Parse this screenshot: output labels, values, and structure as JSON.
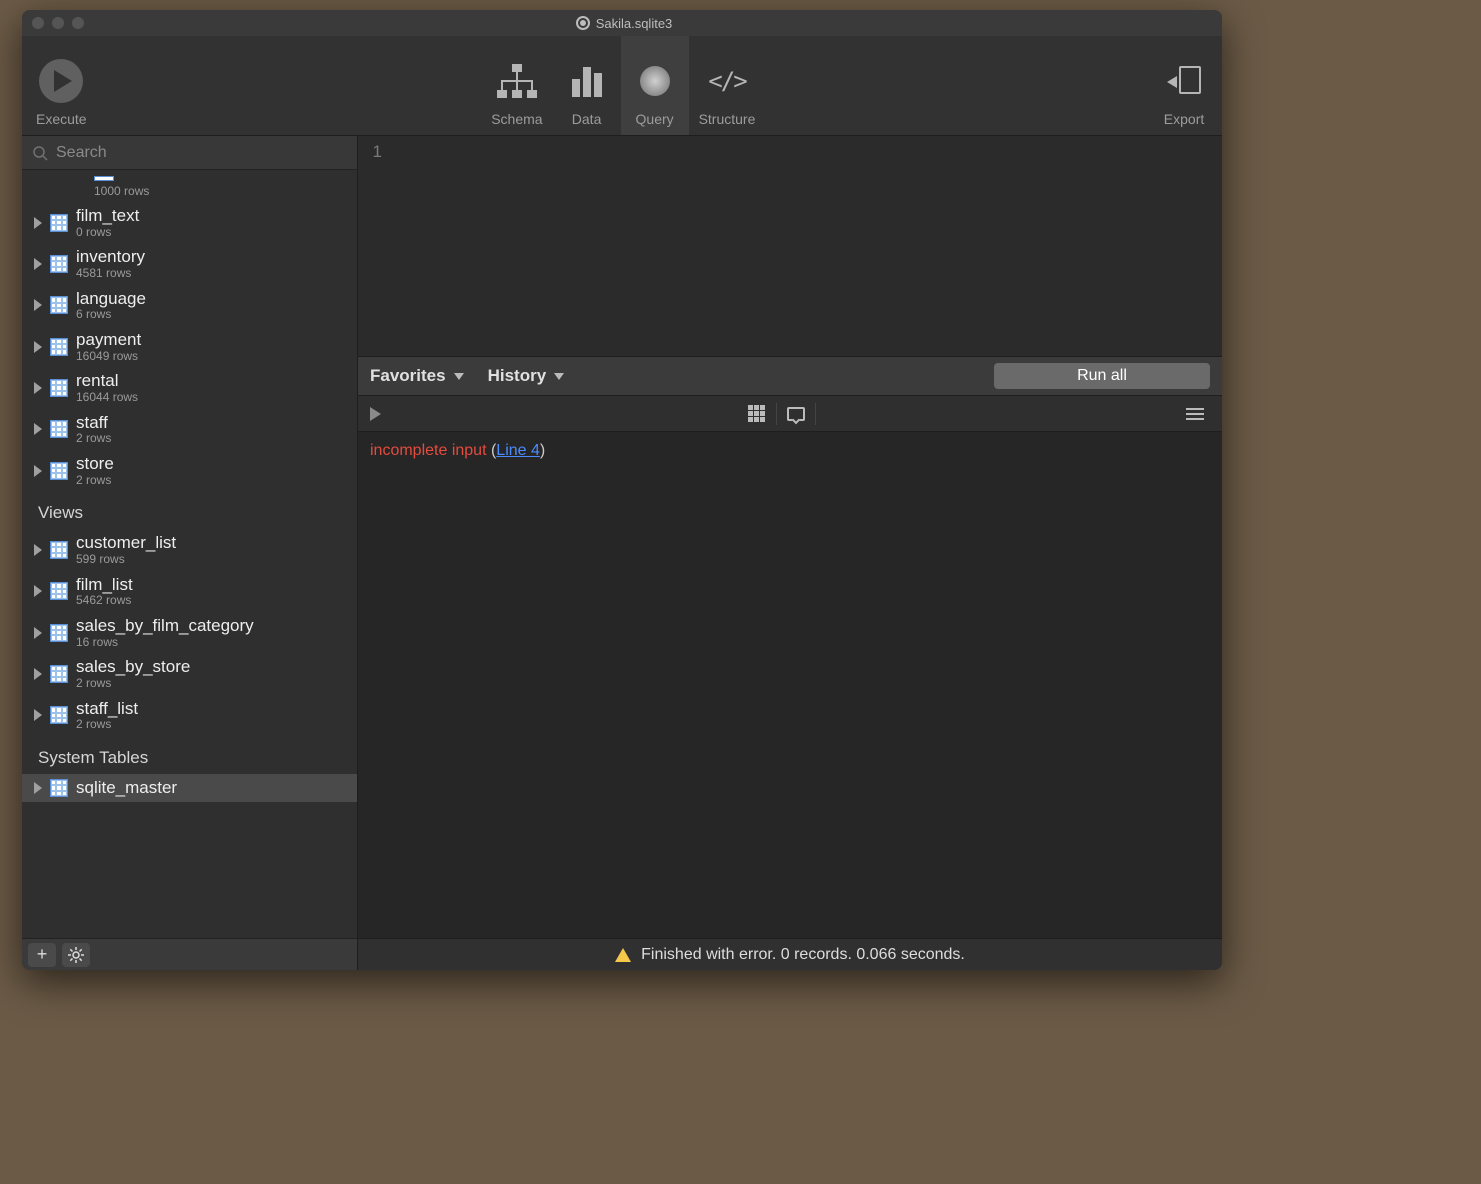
{
  "window_title": "Sakila.sqlite3",
  "toolbar": {
    "execute": "Execute",
    "schema": "Schema",
    "data": "Data",
    "query": "Query",
    "structure": "Structure",
    "export": "Export"
  },
  "search_placeholder": "Search",
  "sidebar": {
    "top_fragment_rows": "1000 rows",
    "tables": [
      {
        "name": "film_text",
        "rows": "0 rows"
      },
      {
        "name": "inventory",
        "rows": "4581 rows"
      },
      {
        "name": "language",
        "rows": "6 rows"
      },
      {
        "name": "payment",
        "rows": "16049 rows"
      },
      {
        "name": "rental",
        "rows": "16044 rows"
      },
      {
        "name": "staff",
        "rows": "2 rows"
      },
      {
        "name": "store",
        "rows": "2 rows"
      }
    ],
    "views_header": "Views",
    "views": [
      {
        "name": "customer_list",
        "rows": "599 rows"
      },
      {
        "name": "film_list",
        "rows": "5462 rows"
      },
      {
        "name": "sales_by_film_category",
        "rows": "16 rows"
      },
      {
        "name": "sales_by_store",
        "rows": "2 rows"
      },
      {
        "name": "staff_list",
        "rows": "2 rows"
      }
    ],
    "system_header": "System Tables",
    "system": [
      {
        "name": "sqlite_master",
        "rows": ""
      }
    ]
  },
  "editor": {
    "line1": "1"
  },
  "midbar": {
    "favorites": "Favorites",
    "history": "History",
    "runall": "Run all"
  },
  "results": {
    "error_prefix": "incomplete input",
    "line_link": "Line 4"
  },
  "status": "Finished with error. 0 records. 0.066 seconds."
}
